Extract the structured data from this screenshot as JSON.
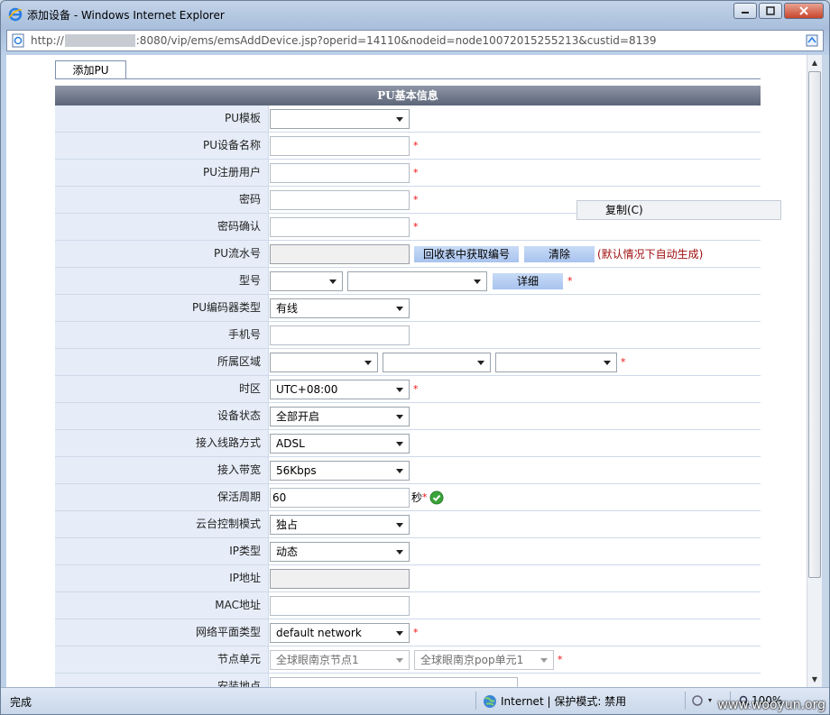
{
  "window": {
    "title": "添加设备 - Windows Internet Explorer",
    "url_prefix": "http://",
    "url_suffix": ":8080/vip/ems/emsAddDevice.jsp?operid=14110&nodeid=node10072015255213&custid=8139"
  },
  "tab": {
    "label": "添加PU"
  },
  "form": {
    "header": "PU基本信息",
    "labels": {
      "pu_template": "PU模板",
      "pu_name": "PU设备名称",
      "pu_user": "PU注册用户",
      "password": "密码",
      "password_confirm": "密码确认",
      "pu_serial": "PU流水号",
      "model": "型号",
      "encoder_type": "PU编码器类型",
      "phone": "手机号",
      "region": "所属区域",
      "timezone": "时区",
      "device_status": "设备状态",
      "access_line": "接入线路方式",
      "bandwidth": "接入带宽",
      "keepalive": "保活周期",
      "ptz_mode": "云台控制模式",
      "ip_type": "IP类型",
      "ip_address": "IP地址",
      "mac_address": "MAC地址",
      "network_plane": "网络平面类型",
      "node_unit": "节点单元",
      "install_location": "安装地点"
    },
    "values": {
      "encoder_type": "有线",
      "timezone": "UTC+08:00",
      "device_status": "全部开启",
      "access_line": "ADSL",
      "bandwidth": "56Kbps",
      "keepalive": "60",
      "ptz_mode": "独占",
      "ip_type": "动态",
      "network_plane": "default network",
      "node_unit_1": "全球眼南京节点1",
      "node_unit_2": "全球眼南京pop单元1"
    },
    "buttons": {
      "fetch_serial": "回收表中获取编号",
      "clear": "清除",
      "detail": "详细"
    },
    "serial_hint": "(默认情况下自动生成)",
    "keepalive_unit": "秒",
    "required_mark": "*"
  },
  "context_menu": {
    "copy": "复制(C)"
  },
  "status": {
    "left": "完成",
    "zone": "Internet | 保护模式: 禁用",
    "zoom": "100%"
  },
  "watermark": "www.wooyun.org",
  "colors": {
    "label_bg": "#e6edf8",
    "header_bg": "#5c6679",
    "required": "#ee1111",
    "hint": "#a01010"
  }
}
